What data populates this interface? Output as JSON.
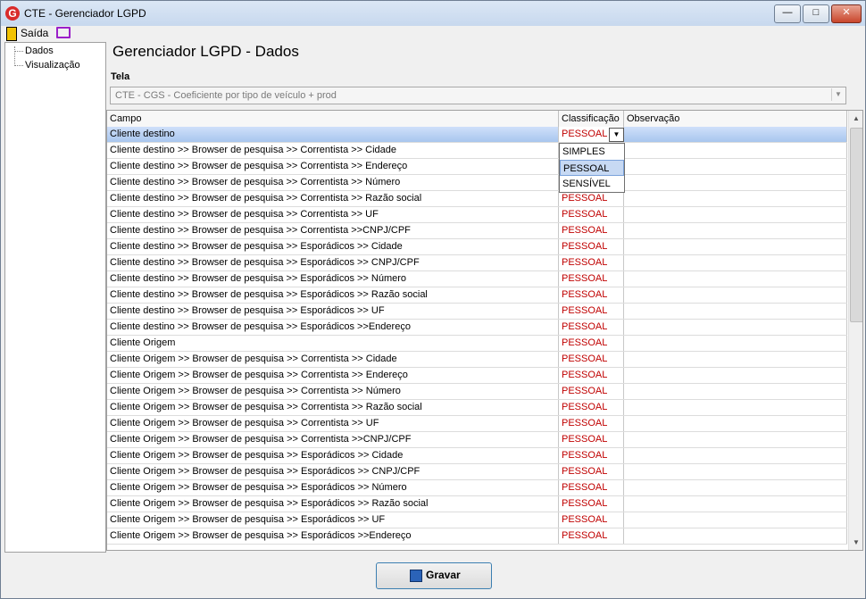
{
  "window": {
    "title": "CTE - Gerenciador LGPD"
  },
  "menu": {
    "exit_label": "Saída"
  },
  "tree": {
    "items": [
      "Dados",
      "Visualização"
    ]
  },
  "page": {
    "title": "Gerenciador LGPD - Dados"
  },
  "tela": {
    "label": "Tela",
    "value": "CTE - CGS - Coeficiente por tipo de veículo + prod"
  },
  "grid": {
    "columns": [
      "Campo",
      "Classificação",
      "Observação"
    ],
    "rows": [
      {
        "campo": "Cliente destino",
        "classificacao": "PESSOAL",
        "observacao": ""
      },
      {
        "campo": "Cliente destino >> Browser de pesquisa >> Correntista >> Cidade",
        "classificacao": "",
        "observacao": ""
      },
      {
        "campo": "Cliente destino >> Browser de pesquisa >> Correntista >> Endereço",
        "classificacao": "",
        "observacao": ""
      },
      {
        "campo": "Cliente destino >> Browser de pesquisa >> Correntista >> Número",
        "classificacao": "",
        "observacao": ""
      },
      {
        "campo": "Cliente destino >> Browser de pesquisa >> Correntista >> Razão social",
        "classificacao": "PESSOAL",
        "observacao": ""
      },
      {
        "campo": "Cliente destino >> Browser de pesquisa >> Correntista >> UF",
        "classificacao": "PESSOAL",
        "observacao": ""
      },
      {
        "campo": "Cliente destino >> Browser de pesquisa >> Correntista >>CNPJ/CPF",
        "classificacao": "PESSOAL",
        "observacao": ""
      },
      {
        "campo": "Cliente destino >> Browser de pesquisa >> Esporádicos >> Cidade",
        "classificacao": "PESSOAL",
        "observacao": ""
      },
      {
        "campo": "Cliente destino >> Browser de pesquisa >> Esporádicos >> CNPJ/CPF",
        "classificacao": "PESSOAL",
        "observacao": ""
      },
      {
        "campo": "Cliente destino >> Browser de pesquisa >> Esporádicos >> Número",
        "classificacao": "PESSOAL",
        "observacao": ""
      },
      {
        "campo": "Cliente destino >> Browser de pesquisa >> Esporádicos >> Razão social",
        "classificacao": "PESSOAL",
        "observacao": ""
      },
      {
        "campo": "Cliente destino >> Browser de pesquisa >> Esporádicos >> UF",
        "classificacao": "PESSOAL",
        "observacao": ""
      },
      {
        "campo": "Cliente destino >> Browser de pesquisa >> Esporádicos >>Endereço",
        "classificacao": "PESSOAL",
        "observacao": ""
      },
      {
        "campo": "Cliente Origem",
        "classificacao": "PESSOAL",
        "observacao": ""
      },
      {
        "campo": "Cliente Origem >> Browser de pesquisa >> Correntista >> Cidade",
        "classificacao": "PESSOAL",
        "observacao": ""
      },
      {
        "campo": "Cliente Origem >> Browser de pesquisa >> Correntista >> Endereço",
        "classificacao": "PESSOAL",
        "observacao": ""
      },
      {
        "campo": "Cliente Origem >> Browser de pesquisa >> Correntista >> Número",
        "classificacao": "PESSOAL",
        "observacao": ""
      },
      {
        "campo": "Cliente Origem >> Browser de pesquisa >> Correntista >> Razão social",
        "classificacao": "PESSOAL",
        "observacao": ""
      },
      {
        "campo": "Cliente Origem >> Browser de pesquisa >> Correntista >> UF",
        "classificacao": "PESSOAL",
        "observacao": ""
      },
      {
        "campo": "Cliente Origem >> Browser de pesquisa >> Correntista >>CNPJ/CPF",
        "classificacao": "PESSOAL",
        "observacao": ""
      },
      {
        "campo": "Cliente Origem >> Browser de pesquisa >> Esporádicos >> Cidade",
        "classificacao": "PESSOAL",
        "observacao": ""
      },
      {
        "campo": "Cliente Origem >> Browser de pesquisa >> Esporádicos >> CNPJ/CPF",
        "classificacao": "PESSOAL",
        "observacao": ""
      },
      {
        "campo": "Cliente Origem >> Browser de pesquisa >> Esporádicos >> Número",
        "classificacao": "PESSOAL",
        "observacao": ""
      },
      {
        "campo": "Cliente Origem >> Browser de pesquisa >> Esporádicos >> Razão social",
        "classificacao": "PESSOAL",
        "observacao": ""
      },
      {
        "campo": "Cliente Origem >> Browser de pesquisa >> Esporádicos >> UF",
        "classificacao": "PESSOAL",
        "observacao": ""
      },
      {
        "campo": "Cliente Origem >> Browser de pesquisa >> Esporádicos >>Endereço",
        "classificacao": "PESSOAL",
        "observacao": ""
      }
    ]
  },
  "dropdown": {
    "options": [
      "SIMPLES",
      "PESSOAL",
      "SENSÍVEL"
    ],
    "highlighted": "PESSOAL"
  },
  "actions": {
    "save_label": "Gravar"
  },
  "icons": {
    "app": "app-logo-icon",
    "exit": "exit-door-icon",
    "screen": "monitor-icon",
    "save": "floppy-disk-icon"
  },
  "colors": {
    "classification_text": "#c00000",
    "selected_row": "#a8c6ee"
  }
}
